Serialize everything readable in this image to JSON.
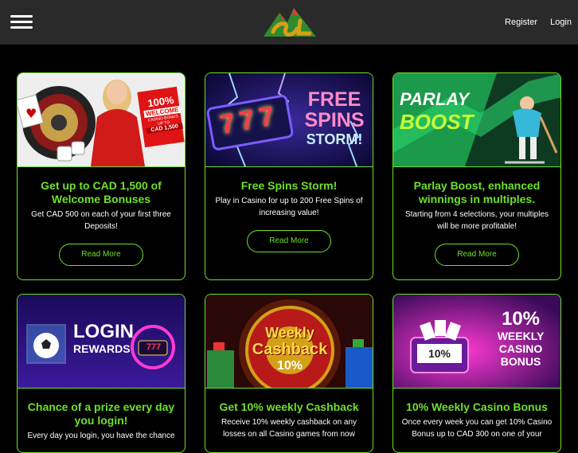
{
  "header": {
    "menu_icon": "hamburger-menu-icon",
    "logo_icon": "sl-logo-icon",
    "register_label": "Register",
    "login_label": "Login"
  },
  "colors": {
    "accent": "#6ee02b",
    "header_bg": "#2a2a2a",
    "page_bg": "#000000"
  },
  "promos": [
    {
      "title": "Get up to CAD 1,500 of Welcome Bonuses",
      "description": "Get CAD 500 on each of your first three Deposits!",
      "button": "Read More",
      "banner": {
        "line1": "100%",
        "line2": "WELCOME",
        "line3": "CASINO BONUS",
        "line4": "UP TO",
        "line5": "CAD 1,500"
      }
    },
    {
      "title": "Free Spins Storm!",
      "description": "Play in Casino for up to 200 Free Spins of increasing value!",
      "button": "Read More",
      "banner": {
        "line1": "FREE",
        "line2": "SPINS",
        "line3": "STORM!",
        "reels": "777"
      }
    },
    {
      "title": "Parlay Boost, enhanced winnings in multiples.",
      "description": "Starting from 4 selections, your multiples will be more profitable!",
      "button": "Read More",
      "banner": {
        "line1": "PARLAY",
        "line2": "BOOST"
      }
    },
    {
      "title": "Chance of a prize every day you login!",
      "description": "Every day you login, you have the chance",
      "banner": {
        "line1": "LOGIN",
        "line2": "REWARDS",
        "reels": "777"
      }
    },
    {
      "title": "Get 10% weekly Cashback",
      "description": "Receive 10% weekly cashback on any losses on all Casino games from now",
      "banner": {
        "line1": "Weekly",
        "line2": "Cashback",
        "line3": "10%"
      }
    },
    {
      "title": "10% Weekly Casino Bonus",
      "description": "Once every week you can get 10% Casino Bonus up to CAD 300 on one of your",
      "banner": {
        "line1": "10%",
        "line2": "WEEKLY",
        "line3": "CASINO",
        "line4": "BONUS",
        "reels": "10%"
      }
    }
  ]
}
